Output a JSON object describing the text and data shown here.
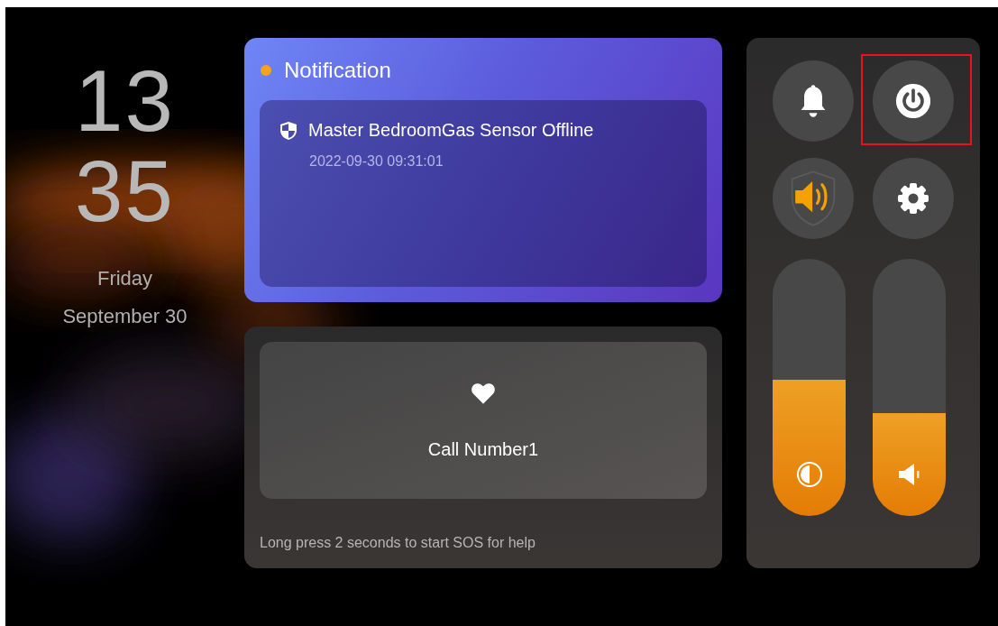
{
  "clock": {
    "hour": "13",
    "minute": "35",
    "weekday": "Friday",
    "date": "September 30"
  },
  "notification": {
    "title": "Notification",
    "unread": true,
    "items": [
      {
        "message": "Master BedroomGas Sensor Offline",
        "time": "2022-09-30 09:31:01"
      }
    ]
  },
  "sos": {
    "button_label": "Call Number1",
    "hint": "Long press 2 seconds to start SOS for help"
  },
  "controls": {
    "buttons": [
      {
        "kind": "bell",
        "highlighted": false
      },
      {
        "kind": "power",
        "highlighted": true
      },
      {
        "kind": "alarm-sound",
        "highlighted": false
      },
      {
        "kind": "settings",
        "highlighted": false
      }
    ],
    "sliders": [
      {
        "kind": "brightness",
        "level": 0.53
      },
      {
        "kind": "volume",
        "level": 0.4
      }
    ]
  }
}
